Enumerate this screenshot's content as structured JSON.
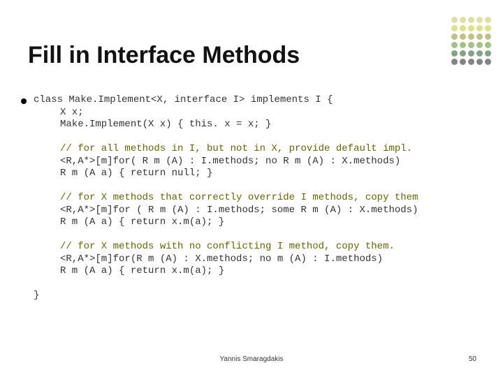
{
  "title": "Fill in Interface Methods",
  "code": {
    "l1": "class Make.Implement<X, interface I> implements I {",
    "l2": "X x;",
    "l3": "Make.Implement(X x) { this. x = x; }",
    "c1": "// for all methods in I, but not in X, provide default impl.",
    "l4": "<R,A*>[m]for( R m (A) : I.methods; no R m (A) : X.methods)",
    "l5": "R m (A a) { return null; }",
    "c2": "// for X methods that correctly override I methods, copy them",
    "l6": "<R,A*>[m]for ( R m (A) : I.methods; some R m (A) : X.methods)",
    "l7": "R m (A a) { return x.m(a); }",
    "c3": "// for X methods with no conflicting I method, copy them.",
    "l8": "<R,A*>[m]for(R m (A) : X.methods; no m (A) : I.methods)",
    "l9": "R m (A a) { return x.m(a); }",
    "l10": "}"
  },
  "footer": {
    "author": "Yannis Smaragdakis",
    "page": "50"
  },
  "dot_colors": [
    "#cccc66",
    "#cccc66",
    "#cccc66",
    "#cccc66",
    "#cccc66",
    "#cccc33",
    "#cccc33",
    "#cccc33",
    "#cccc33",
    "#cccc33",
    "#999933",
    "#999933",
    "#999933",
    "#999933",
    "#999933",
    "#669933",
    "#669933",
    "#669933",
    "#669933",
    "#669933",
    "#336633",
    "#336633",
    "#336633",
    "#336633",
    "#336633",
    "#333333",
    "#333333",
    "#333333",
    "#333333",
    "#333333"
  ]
}
